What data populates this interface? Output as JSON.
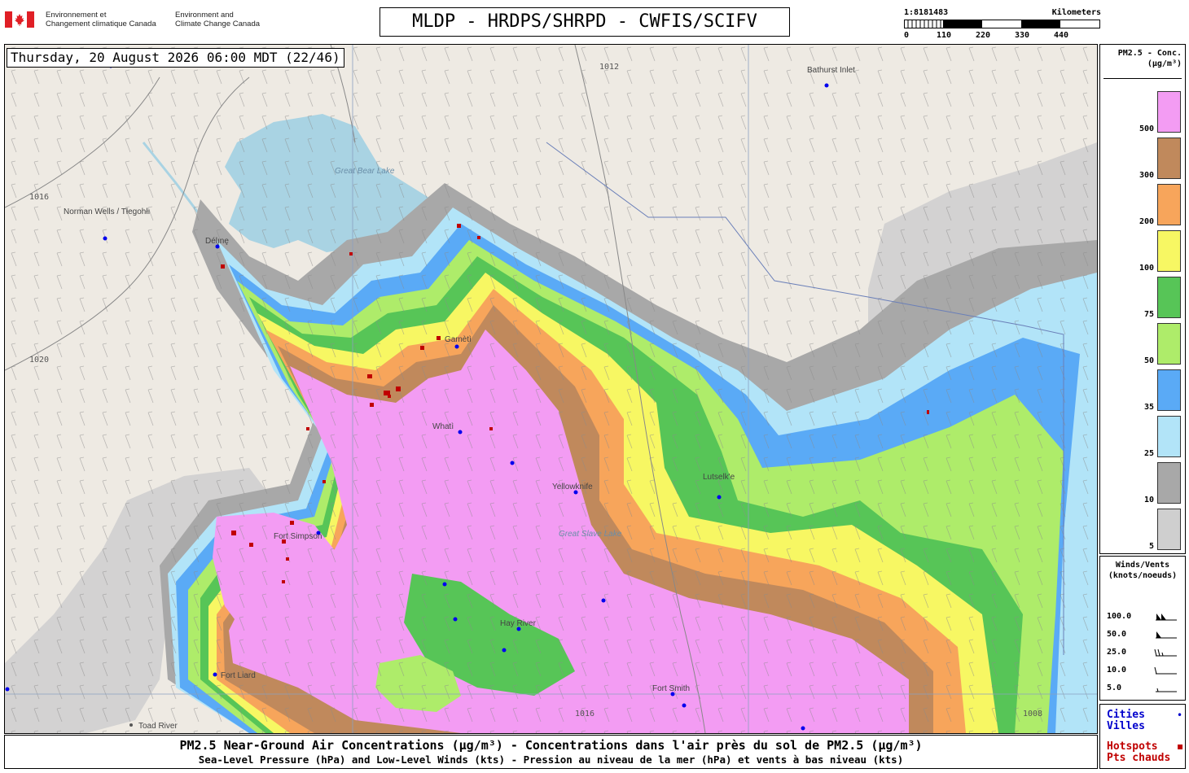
{
  "header": {
    "gov_fr": [
      "Environnement et",
      "Changement climatique Canada"
    ],
    "gov_en": [
      "Environment and",
      "Climate Change Canada"
    ],
    "model_title": "MLDP - HRDPS/SHRPD - CWFIS/SCIFV",
    "scale": {
      "ratio": "1:8181483",
      "unit": "Kilometers",
      "ticks": [
        "0",
        "110",
        "220",
        "330",
        "440"
      ]
    }
  },
  "map": {
    "datetime": "Thursday, 20 August 2026 06:00 MDT (22/46)",
    "cities": [
      {
        "name": "Bathurst Inlet"
      },
      {
        "name": "Norman Wells / Tłegohłı"
      },
      {
        "name": "Whatì"
      },
      {
        "name": "Yellowknife"
      },
      {
        "name": "Lutselk'e"
      },
      {
        "name": "Hay River"
      },
      {
        "name": "Fort Smith"
      },
      {
        "name": "Fort Liard"
      },
      {
        "name": "Fort Simpson"
      },
      {
        "name": "Toad River"
      },
      {
        "name": "Délı̨nę"
      },
      {
        "name": "Gamètì"
      }
    ],
    "lakes": [
      {
        "name": "Great Bear Lake"
      },
      {
        "name": "Great Slave Lake"
      }
    ],
    "isobars": [
      "1012",
      "1016",
      "1020",
      "1008"
    ],
    "colors": {
      "land": "#eeeae3",
      "water": "#a9d3e3",
      "pm_500": "#f39cf3",
      "pm_300": "#c0895c",
      "pm_200": "#f7a55b",
      "pm_100": "#f7f763",
      "pm_75": "#57c557",
      "pm_50": "#aeec6a",
      "pm_35": "#5aaaf6",
      "pm_25": "#b2e4f8",
      "pm_10": "#a8a8a8",
      "pm_5": "#cfcfcf",
      "city_dot": "#0000ee",
      "hotspot": "#c00000"
    }
  },
  "legend": {
    "title": "PM2.5 - Conc.\n(µg/m³)",
    "levels": [
      {
        "label": "500",
        "color": "#f39cf3"
      },
      {
        "label": "300",
        "color": "#c0895c"
      },
      {
        "label": "200",
        "color": "#f7a55b"
      },
      {
        "label": "100",
        "color": "#f7f763"
      },
      {
        "label": "75",
        "color": "#57c557"
      },
      {
        "label": "50",
        "color": "#aeec6a"
      },
      {
        "label": "35",
        "color": "#5aaaf6"
      },
      {
        "label": "25",
        "color": "#b2e4f8"
      },
      {
        "label": "10",
        "color": "#a8a8a8"
      },
      {
        "label": "5",
        "color": "#cfcfcf"
      }
    ]
  },
  "winds": {
    "title": "Winds/Vents\n(knots/noeuds)",
    "rows": [
      {
        "label": "100.0",
        "barb": "pennant-pennant"
      },
      {
        "label": "50.0",
        "barb": "pennant"
      },
      {
        "label": "25.0",
        "barb": "double-half"
      },
      {
        "label": "10.0",
        "barb": "full"
      },
      {
        "label": "5.0",
        "barb": "half"
      }
    ]
  },
  "markers": {
    "cities_en": "Cities",
    "cities_fr": "Villes",
    "cities_symbol": "•",
    "hotspots_en": "Hotspots",
    "hotspots_fr": "Pts chauds",
    "hotspots_symbol": "▪"
  },
  "footer": {
    "line1": "PM2.5 Near-Ground Air Concentrations (µg/m³) - Concentrations dans l'air près du sol de PM2.5 (µg/m³)",
    "line2": "Sea-Level Pressure (hPa) and Low-Level Winds (kts) - Pression au niveau de la mer (hPa) et vents à bas niveau (kts)"
  }
}
